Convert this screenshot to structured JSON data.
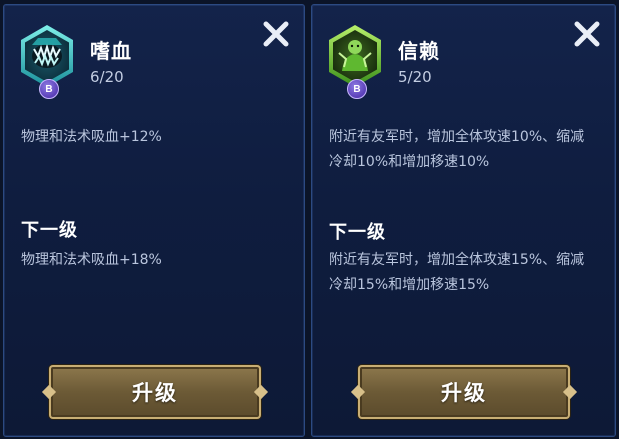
{
  "cards": [
    {
      "icon": "fanged-mouth-icon",
      "badge": "B",
      "name": "嗜血",
      "level": "6/20",
      "current_desc": "物理和法术吸血+12%",
      "next_title": "下一级",
      "next_desc": "物理和法术吸血+18%",
      "upgrade_label": "升级",
      "accent": "#2fd0c8"
    },
    {
      "icon": "trust-hero-icon",
      "badge": "B",
      "name": "信赖",
      "level": "5/20",
      "current_desc": "附近有友军时，增加全体攻速10%、缩减冷却10%和增加移速10%",
      "next_title": "下一级",
      "next_desc": "附近有友军时，增加全体攻速15%、缩减冷却15%和增加移速15%",
      "upgrade_label": "升级",
      "accent": "#6edb3a"
    }
  ]
}
